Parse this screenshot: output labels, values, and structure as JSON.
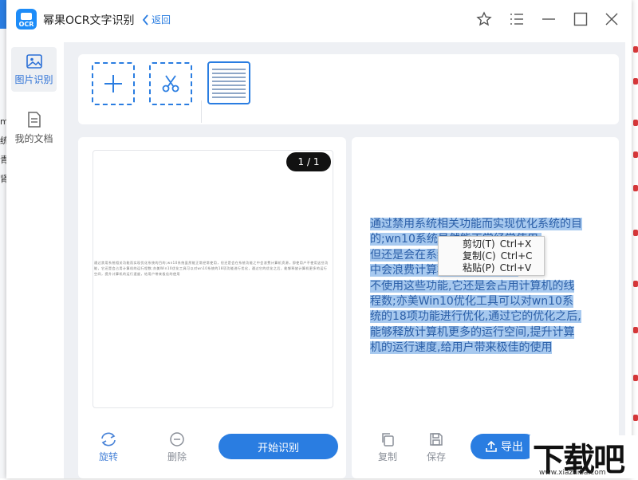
{
  "window": {
    "title": "幂果OCR文字识别",
    "back_label": "返回",
    "icons": [
      "star-icon",
      "menu-icon",
      "minimize-icon",
      "maximize-icon",
      "close-icon"
    ]
  },
  "background_left": {
    "chars": [
      "m",
      "统",
      "青",
      "肾"
    ]
  },
  "sidebar": {
    "items": [
      {
        "label": "图片识别",
        "icon": "image-icon",
        "active": true
      },
      {
        "label": "我的文档",
        "icon": "document-icon",
        "active": false
      }
    ]
  },
  "toolbar": {
    "add_icon": "plus-icon",
    "cut_icon": "scissors-icon"
  },
  "preview": {
    "page_indicator": "1 / 1",
    "text": "通过禁用系统相关功能而实现优化系统的目的;wn10系统虽然能正常经常使用，但还是会在系统功能之中会浪费计算机资源，即使用户不使用这些功能，它还是会占用计算机的运行程数;亦美Win10优化工具可以对wn10系统的18项功能进行优化，通过它的优化之后，能够释放计算机更多的运行空间，提升计算机的运行速度，给用户带来极佳的使用"
  },
  "left_actions": {
    "rotate_label": "旋转",
    "delete_label": "删除",
    "start_label": "开始识别"
  },
  "result": {
    "lines": [
      "通过禁用系统相关功能而实现优化系统的目",
      "的;wn10系统虽然能正常经常使用,",
      "但还是会在系统功能之",
      "中会浪费计算机资源,即使用户",
      "不使用这些功能,它还是会占用计算机的线",
      "程数;亦美Win10优化工具可以对wn10系",
      "统的18项功能进行优化,通过它的优化之后,",
      "能够释放计算机更多的运行空间,提升计算",
      "机的运行速度,给用户带来极佳的使用"
    ]
  },
  "right_actions": {
    "copy_label": "复制",
    "save_label": "保存",
    "export_label": "导出"
  },
  "context_menu": {
    "items": [
      {
        "label": "剪切(T)",
        "shortcut": "Ctrl+X"
      },
      {
        "label": "复制(C)",
        "shortcut": "Ctrl+C"
      },
      {
        "label": "粘贴(P)",
        "shortcut": "Ctrl+V"
      }
    ]
  },
  "watermark": {
    "main": "下载吧",
    "sub": "www.xiazaiba.com"
  },
  "colors": {
    "accent": "#2a7de1",
    "selection": "#a7c9ef",
    "panel_bg": "#eef0f4"
  }
}
